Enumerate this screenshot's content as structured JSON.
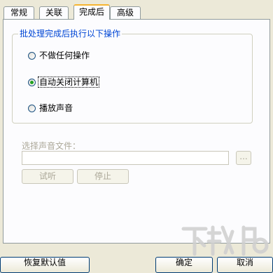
{
  "tabs": [
    "常规",
    "关联",
    "完成后",
    "高级"
  ],
  "group": {
    "title": "批处理完成后执行以下操作",
    "options": [
      "不做任何操作",
      "自动关闭计算机",
      "播放声音"
    ],
    "selected_index": 1
  },
  "sound": {
    "label": "选择声音文件：",
    "value": "",
    "browse_label": "...",
    "listen_label": "试听",
    "stop_label": "停止"
  },
  "footer": {
    "restore_label": "恢复默认值",
    "ok_label": "确定",
    "cancel_label": "取消"
  },
  "watermark_text": "下载吧"
}
